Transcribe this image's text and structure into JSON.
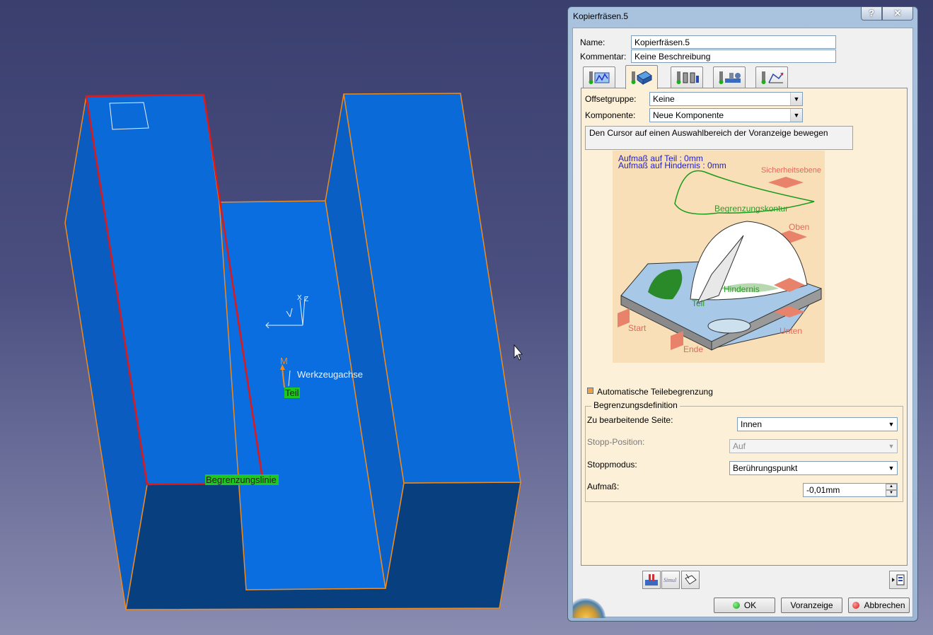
{
  "viewport": {
    "labels": {
      "axis_label": "Werkzeugachse",
      "axis_m": "M",
      "part_tag": "Teil",
      "boundary_tag": "Begrenzungslinie"
    }
  },
  "dialog": {
    "title": "Kopierfräsen.5",
    "help_label": "?",
    "close_label": "✕",
    "name_label": "Name:",
    "name_value": "Kopierfräsen.5",
    "comment_label": "Kommentar:",
    "comment_value": "Keine Beschreibung",
    "tabs": [
      {
        "icon": "strategy-tab-icon"
      },
      {
        "icon": "geometry-tab-icon"
      },
      {
        "icon": "tool-tab-icon"
      },
      {
        "icon": "feeds-speeds-tab-icon"
      },
      {
        "icon": "macros-tab-icon"
      }
    ],
    "offset_group_label": "Offsetgruppe:",
    "offset_group_value": "Keine",
    "component_label": "Komponente:",
    "component_value": "Neue Komponente",
    "hint": "Den Cursor auf einen Auswahlbereich der Voranzeige bewegen",
    "picture": {
      "stock_part": "Aufmaß auf Teil : 0mm",
      "stock_obstacle": "Aufmaß auf Hindernis : 0mm",
      "safety_plane": "Sicherheitsebene",
      "boundary_contour": "Begrenzungskontur",
      "top": "Oben",
      "obstacle": "Hindernis",
      "part": "Teil",
      "start": "Start",
      "end": "Ende",
      "bottom": "Unten"
    },
    "auto_limit_label": "Automatische Teilebegrenzung",
    "limit_def": {
      "title": "Begrenzungsdefinition",
      "side_label": "Zu bearbeitende Seite:",
      "side_value": "Innen",
      "stop_position_label": "Stopp-Position:",
      "stop_position_value": "Auf",
      "stop_mode_label": "Stoppmodus:",
      "stop_mode_value": "Berührungspunkt",
      "offset_label": "Aufmaß:",
      "offset_value": "-0,01mm"
    },
    "buttons": {
      "ok": "OK",
      "preview": "Voranzeige",
      "cancel": "Abbrechen"
    },
    "colors": {
      "panel_bg": "#fdf0d8",
      "titlebar": "#a9c3de",
      "ok_dot": "#1aa01a",
      "cancel_dot": "#d01818"
    }
  }
}
